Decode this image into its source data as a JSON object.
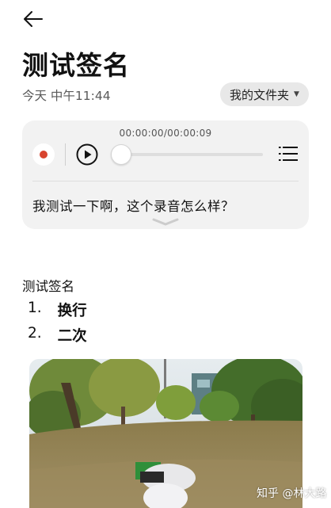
{
  "note": {
    "title": "测试签名",
    "date": "今天 中午11:44",
    "folder": "我的文件夹"
  },
  "audio": {
    "time_display": "00:00:00/00:00:09",
    "progress_fraction": 0.0,
    "transcript": "我测试一下啊，这个录音怎么样？"
  },
  "content": {
    "heading": "测试签名",
    "list": [
      {
        "num": "1.",
        "text": "换行"
      },
      {
        "num": "2.",
        "text": "二次"
      }
    ]
  },
  "watermark": "知乎 @林大路",
  "colors": {
    "record_dot": "#d8442f",
    "card_bg": "#f2f2f2",
    "chip_bg": "#e8e8e8"
  }
}
